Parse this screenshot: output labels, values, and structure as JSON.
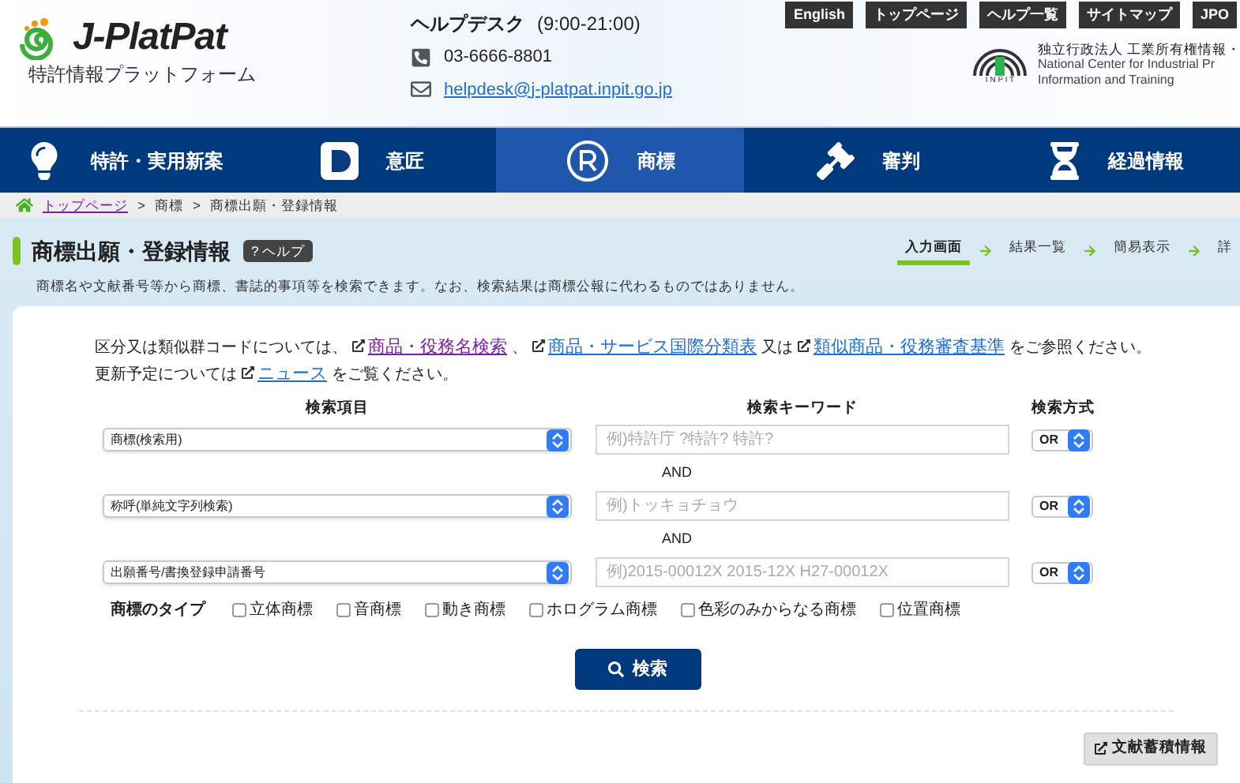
{
  "header": {
    "logo": {
      "name": "J-PlatPat",
      "subtitle": "特許情報プラットフォーム"
    },
    "helpdesk": {
      "label": "ヘルプデスク",
      "hours": "(9:00-21:00)",
      "phone": "03-6666-8801",
      "email": "helpdesk@j-platpat.inpit.go.jp"
    },
    "top_links": [
      "English",
      "トップページ",
      "ヘルプ一覧",
      "サイトマップ",
      "JPO"
    ],
    "inpit": {
      "abbr": "I N P I T",
      "line_1": "独立行政法人 工業所有権情報・",
      "line_2": "National Center for Industrial Pr",
      "line_3": "Information and Training"
    }
  },
  "nav": [
    {
      "label": "特許・実用新案",
      "kind": "bulb",
      "selected": false
    },
    {
      "label": "意匠",
      "kind": "design",
      "selected": false
    },
    {
      "label": "商標",
      "kind": "trademark",
      "selected": true
    },
    {
      "label": "審判",
      "kind": "gavel",
      "selected": false
    },
    {
      "label": "経過情報",
      "kind": "hourglass",
      "selected": false
    }
  ],
  "breadcrumb": [
    {
      "kind": "link",
      "label": "トップページ"
    },
    {
      "kind": "separator",
      "label": ">"
    },
    {
      "kind": "text",
      "label": "商標"
    },
    {
      "kind": "separator",
      "label": ">"
    },
    {
      "kind": "text",
      "label": "商標出願・登録情報"
    }
  ],
  "page": {
    "title": "商標出願・登録情報",
    "help": "? ヘルプ",
    "description": "商標名や文献番号等から商標、書誌的事項等を検索できます。なお、検索結果は商標公報に代わるものではありません。",
    "steps": [
      {
        "label": "入力画面",
        "selected": true
      },
      {
        "label": "結果一覧",
        "selected": false
      },
      {
        "label": "簡易表示",
        "selected": false
      },
      {
        "label": "詳",
        "selected": false
      }
    ]
  },
  "notice": {
    "line_1": [
      {
        "kind": "text",
        "text": "区分又は類似群コードについては、"
      },
      {
        "kind": "link",
        "text": "商品・役務名検索",
        "visited": true
      },
      {
        "kind": "text",
        "text": "、"
      },
      {
        "kind": "link",
        "text": "商品・サービス国際分類表",
        "visited": false
      },
      {
        "kind": "text",
        "text": "又は"
      },
      {
        "kind": "link",
        "text": "類似商品・役務審査基準",
        "visited": false
      },
      {
        "kind": "text",
        "text": "をご参照ください。"
      }
    ],
    "line_2": [
      {
        "kind": "text",
        "text": "更新予定については"
      },
      {
        "kind": "link",
        "text": "ニュース",
        "visited": false
      },
      {
        "kind": "text",
        "text": "をご覧ください。"
      }
    ]
  },
  "form": {
    "columns": [
      "検索項目",
      "検索キーワード",
      "検索方式"
    ],
    "rows": [
      {
        "item": "商標(検索用)",
        "placeholder": "例)特許庁 ?特許? 特許?",
        "mode": "OR"
      },
      {
        "item": "称呼(単純文字列検索)",
        "placeholder": "例)トッキョチョウ",
        "mode": "OR"
      },
      {
        "item": "出願番号/書換登録申請番号",
        "placeholder": "例)2015-00012X 2015-12X H27-00012X",
        "mode": "OR"
      }
    ],
    "joiner": [
      "AND",
      "AND"
    ],
    "type_label": "商標のタイプ",
    "types": [
      {
        "label": "立体商標",
        "checked": false
      },
      {
        "label": "音商標",
        "checked": false
      },
      {
        "label": "動き商標",
        "checked": false
      },
      {
        "label": "ホログラム商標",
        "checked": false
      },
      {
        "label": "色彩のみからなる商標",
        "checked": false
      },
      {
        "label": "位置商標",
        "checked": false
      }
    ],
    "search_button": "検索"
  },
  "footer_button": "文献蓄積情報"
}
